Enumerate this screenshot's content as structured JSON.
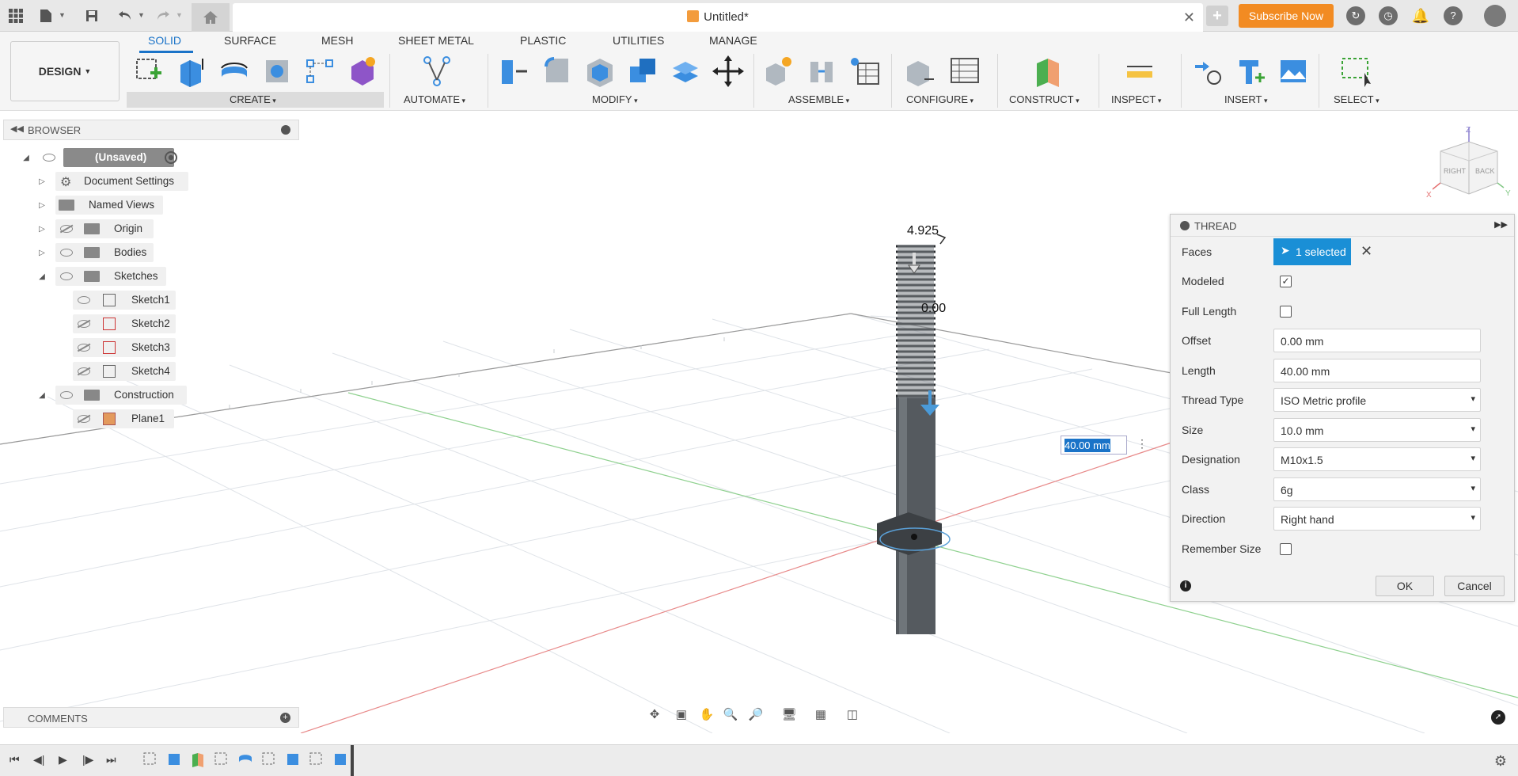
{
  "titlebar": {
    "doc_title": "Untitled*",
    "subscribe_label": "Subscribe Now",
    "accent": "#f28b22"
  },
  "ribbon": {
    "design_label": "DESIGN",
    "tabs": [
      "SOLID",
      "SURFACE",
      "MESH",
      "SHEET METAL",
      "PLASTIC",
      "UTILITIES",
      "MANAGE"
    ],
    "active_tab": "SOLID",
    "groups": [
      "CREATE",
      "AUTOMATE",
      "MODIFY",
      "ASSEMBLE",
      "CONFIGURE",
      "CONSTRUCT",
      "INSPECT",
      "INSERT",
      "SELECT"
    ]
  },
  "browser": {
    "title": "BROWSER",
    "root": "(Unsaved)",
    "items": [
      {
        "label": "Document Settings"
      },
      {
        "label": "Named Views"
      },
      {
        "label": "Origin"
      },
      {
        "label": "Bodies"
      },
      {
        "label": "Sketches"
      },
      {
        "label": "Sketch1"
      },
      {
        "label": "Sketch2"
      },
      {
        "label": "Sketch3"
      },
      {
        "label": "Sketch4"
      },
      {
        "label": "Construction"
      },
      {
        "label": "Plane1"
      }
    ]
  },
  "comments": {
    "title": "COMMENTS"
  },
  "thread": {
    "title": "THREAD",
    "faces_label": "Faces",
    "faces_value": "1 selected",
    "modeled_label": "Modeled",
    "modeled_checked": true,
    "full_length_label": "Full Length",
    "full_length_checked": false,
    "offset_label": "Offset",
    "offset_value": "0.00 mm",
    "length_label": "Length",
    "length_value": "40.00 mm",
    "thread_type_label": "Thread Type",
    "thread_type_value": "ISO Metric profile",
    "size_label": "Size",
    "size_value": "10.0 mm",
    "designation_label": "Designation",
    "designation_value": "M10x1.5",
    "class_label": "Class",
    "class_value": "6g",
    "direction_label": "Direction",
    "direction_value": "Right hand",
    "remember_label": "Remember Size",
    "remember_checked": false,
    "ok_label": "OK",
    "cancel_label": "Cancel"
  },
  "viewport": {
    "dim_top": "4.925",
    "dim_mid": "0.00",
    "dim_input": "40.00 mm",
    "viewcube_right": "RIGHT",
    "viewcube_back": "BACK",
    "axis_x": "X",
    "axis_y": "Y",
    "axis_z": "Z"
  }
}
